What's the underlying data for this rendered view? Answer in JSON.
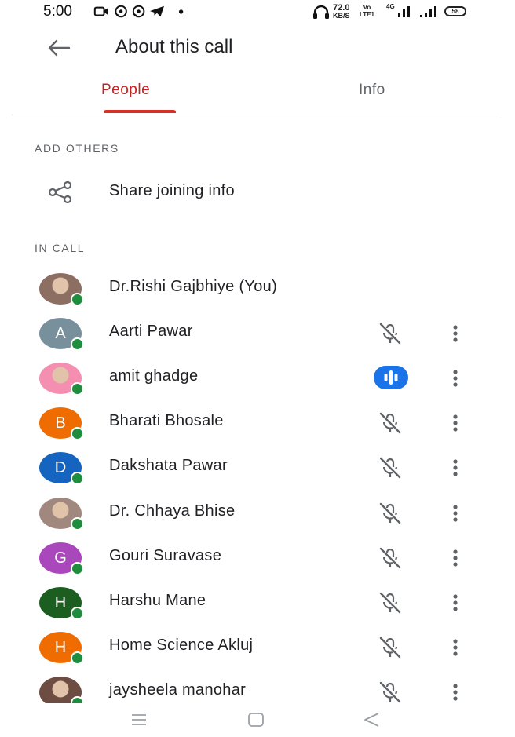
{
  "status_bar": {
    "time": "5:00",
    "speed_value": "72.0",
    "speed_unit": "KB/S",
    "volte_top": "Vo",
    "volte_bottom": "LTE1",
    "network": "4G",
    "battery": "58",
    "left_icons": [
      "video-camera-icon",
      "whatsapp-icon",
      "whatsapp-icon",
      "telegram-icon",
      "dot-icon"
    ],
    "right_icons": [
      "headphones-icon",
      "signal-icon",
      "signal-icon",
      "battery-icon"
    ]
  },
  "header": {
    "title": "About this call",
    "back_icon": "arrow-left-icon"
  },
  "tabs": [
    {
      "label": "People",
      "selected": true
    },
    {
      "label": "Info",
      "selected": false
    }
  ],
  "add_others": {
    "section_label": "ADD OTHERS",
    "share_label": "Share joining info",
    "share_icon": "share-icon"
  },
  "in_call": {
    "section_label": "IN CALL",
    "participants": [
      {
        "name": "Dr.Rishi Gajbhiye (You)",
        "initial": "",
        "avatar_color": "#8d6e63",
        "photo": true,
        "status": "none"
      },
      {
        "name": "Aarti Pawar",
        "initial": "A",
        "avatar_color": "#78909c",
        "photo": false,
        "status": "muted"
      },
      {
        "name": "amit ghadge",
        "initial": "",
        "avatar_color": "#f48fb1",
        "photo": true,
        "status": "speaking"
      },
      {
        "name": "Bharati Bhosale",
        "initial": "B",
        "avatar_color": "#ef6c00",
        "photo": false,
        "status": "muted"
      },
      {
        "name": "Dakshata Pawar",
        "initial": "D",
        "avatar_color": "#1565c0",
        "photo": false,
        "status": "muted"
      },
      {
        "name": "Dr. Chhaya Bhise",
        "initial": "",
        "avatar_color": "#a1887f",
        "photo": true,
        "status": "muted"
      },
      {
        "name": "Gouri Suravase",
        "initial": "G",
        "avatar_color": "#ab47bc",
        "photo": false,
        "status": "muted"
      },
      {
        "name": "Harshu Mane",
        "initial": "H",
        "avatar_color": "#1b5e20",
        "photo": false,
        "status": "muted"
      },
      {
        "name": "Home Science Akluj",
        "initial": "H",
        "avatar_color": "#ef6c00",
        "photo": false,
        "status": "muted"
      },
      {
        "name": "jaysheela manohar",
        "initial": "",
        "avatar_color": "#6d4c41",
        "photo": true,
        "status": "muted"
      }
    ]
  },
  "colors": {
    "accent": "#d93025",
    "presence": "#1e8e3e",
    "speaking": "#1a73e8",
    "muted_icon": "#5f6368"
  },
  "nav_bar": {
    "icons": [
      "menu-icon",
      "home-icon",
      "back-triangle-icon"
    ]
  }
}
